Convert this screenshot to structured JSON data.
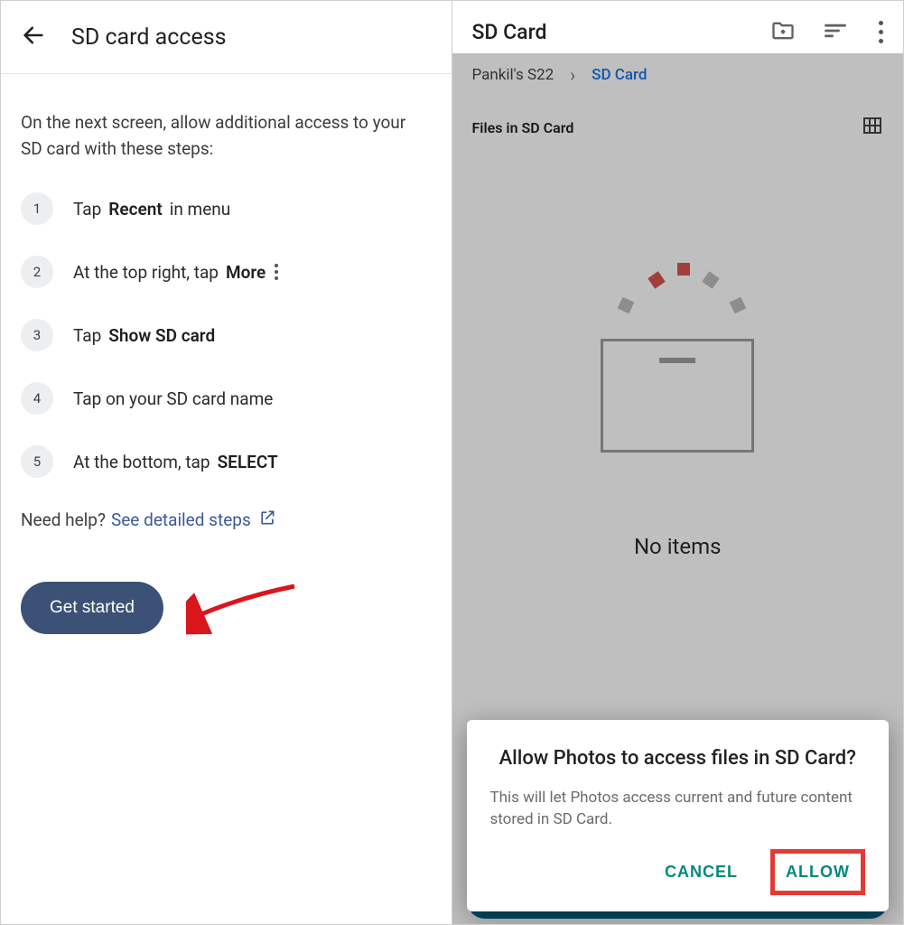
{
  "left": {
    "title": "SD card access",
    "intro": "On the next screen, allow additional access to your SD card with these steps:",
    "steps": {
      "s1": {
        "num": "1",
        "pre": "Tap ",
        "bold": "Recent",
        "post": " in menu"
      },
      "s2": {
        "num": "2",
        "pre": "At the top right, tap ",
        "bold": "More"
      },
      "s3": {
        "num": "3",
        "pre": "Tap ",
        "bold": "Show SD card"
      },
      "s4": {
        "num": "4",
        "text": "Tap on your SD card name"
      },
      "s5": {
        "num": "5",
        "pre": "At the bottom, tap ",
        "bold": "SELECT"
      }
    },
    "help_label": "Need help?",
    "help_link": "See detailed steps",
    "cta": "Get started"
  },
  "right": {
    "title": "SD Card",
    "breadcrumb_root": "Pankil's S22",
    "breadcrumb_current": "SD Card",
    "files_header": "Files in SD Card",
    "empty_text": "No items",
    "dialog": {
      "title": "Allow Photos to access files in SD Card?",
      "body": "This will let Photos access current and future content stored in SD Card.",
      "cancel": "CANCEL",
      "allow": "ALLOW"
    }
  }
}
